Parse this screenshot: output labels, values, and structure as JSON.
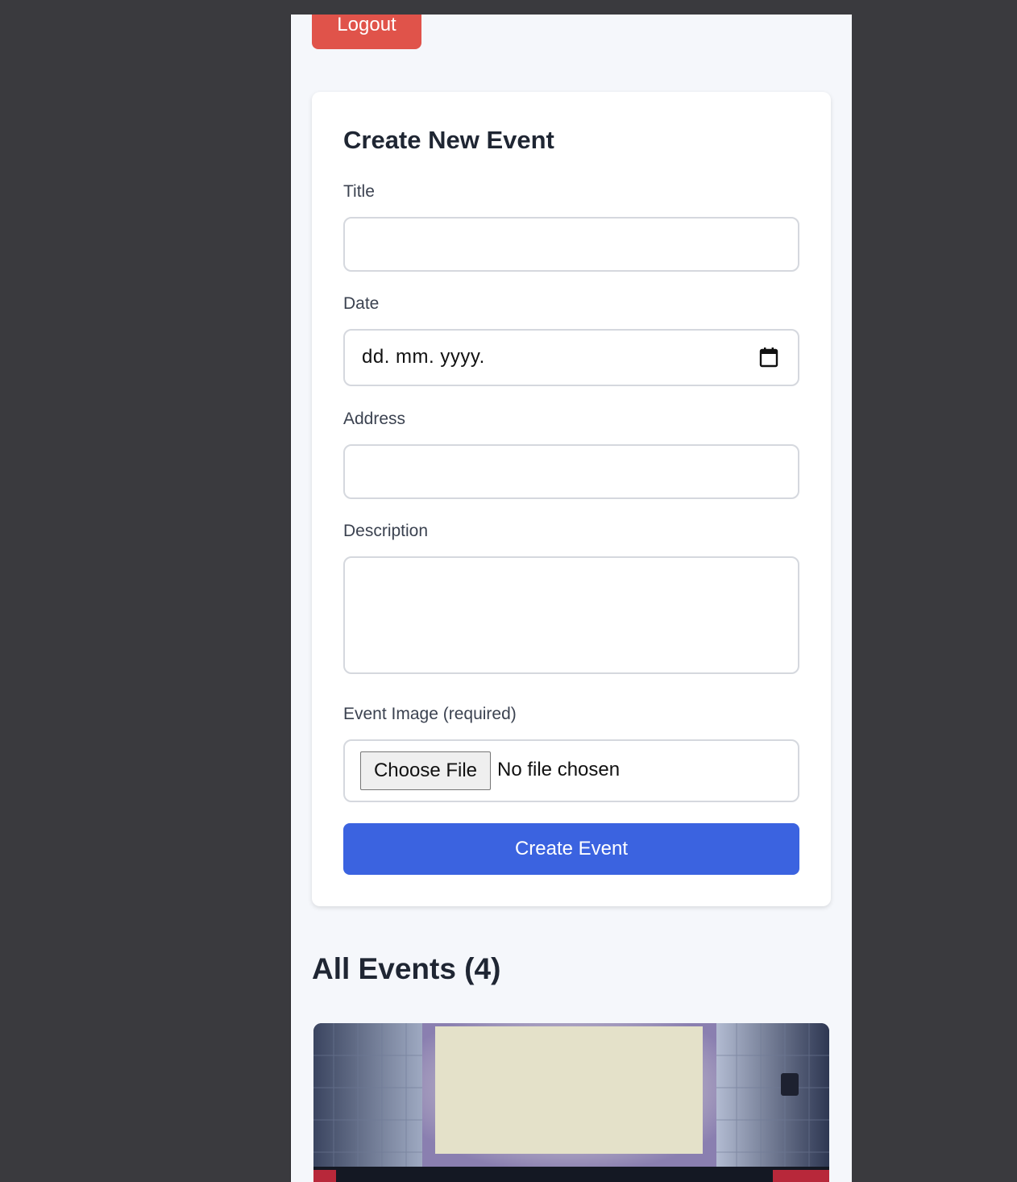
{
  "header": {
    "logout_label": "Logout"
  },
  "form": {
    "title": "Create New Event",
    "fields": {
      "title_label": "Title",
      "title_value": "",
      "date_label": "Date",
      "date_placeholder": "dd. mm. yyyy.",
      "address_label": "Address",
      "address_value": "",
      "description_label": "Description",
      "description_value": "",
      "image_label": "Event Image (required)",
      "choose_file_label": "Choose File",
      "no_file_text": "No file chosen"
    },
    "submit_label": "Create Event"
  },
  "events": {
    "heading": "All Events (4)",
    "count": 4
  },
  "colors": {
    "page_bg": "#f5f7fb",
    "outer_bg": "#3a3a3e",
    "logout": "#e0534a",
    "primary": "#3b63e0",
    "text": "#1f2633"
  },
  "icons": {
    "date_picker": "calendar-icon"
  }
}
